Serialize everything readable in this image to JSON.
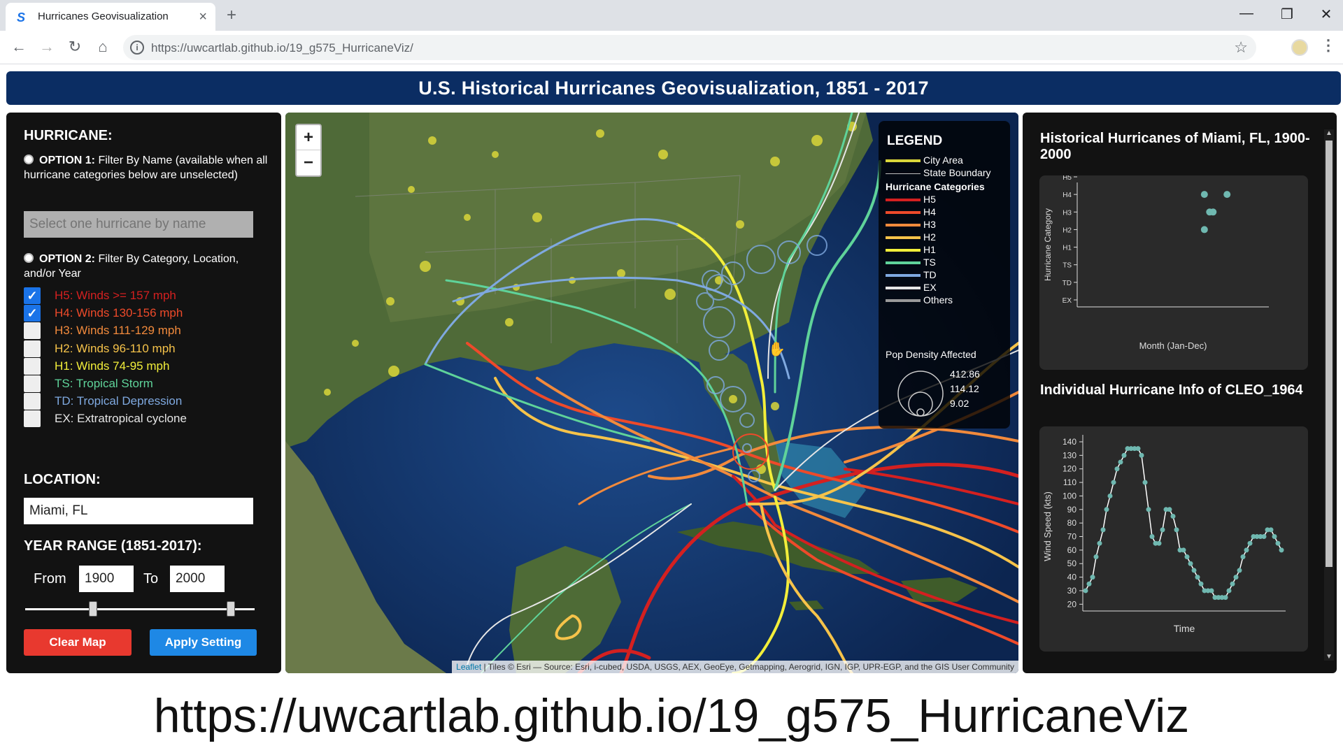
{
  "browser": {
    "tab_title": "Hurricanes Geovisualization",
    "url": "https://uwcartlab.github.io/19_g575_HurricaneViz/"
  },
  "app": {
    "title": "U.S. Historical Hurricanes Geovisualization, 1851 - 2017"
  },
  "left_panel": {
    "hurricane_heading": "HURRICANE:",
    "option1_bold": "OPTION 1:",
    "option1_text": "Filter By Name (available when all hurricane categories below are unselected)",
    "name_placeholder": "Select one hurricane by name",
    "option2_bold": "OPTION 2:",
    "option2_text": "Filter By Category, Location, and/or Year",
    "categories": [
      {
        "label": "H5: Winds >= 157 mph",
        "color": "#d42020",
        "checked": true
      },
      {
        "label": "H4: Winds 130-156 mph",
        "color": "#ee4a2a",
        "checked": true
      },
      {
        "label": "H3: Winds 111-129 mph",
        "color": "#f28a3c",
        "checked": false
      },
      {
        "label": "H2: Winds 96-110 mph",
        "color": "#f6c34a",
        "checked": false
      },
      {
        "label": "H1: Winds 74-95 mph",
        "color": "#f2ee3a",
        "checked": false
      },
      {
        "label": "TS: Tropical Storm",
        "color": "#5fd39a",
        "checked": false
      },
      {
        "label": "TD: Tropical Depression",
        "color": "#7fa9e0",
        "checked": false
      },
      {
        "label": "EX: Extratropical cyclone",
        "color": "#e6e6e6",
        "checked": false
      }
    ],
    "location_heading": "LOCATION:",
    "location_value": "Miami, FL",
    "year_heading": "YEAR RANGE (1851-2017):",
    "from_label": "From",
    "from_value": "1900",
    "to_label": "To",
    "to_value": "2000",
    "year_slider": {
      "min": 1851,
      "max": 2017,
      "from": 1900,
      "to": 2000
    },
    "clear_label": "Clear Map",
    "apply_label": "Apply Setting"
  },
  "map": {
    "zoom_in": "+",
    "zoom_out": "−",
    "legend": {
      "title": "LEGEND",
      "city_area": "City Area",
      "state_boundary": "State Boundary",
      "categories_heading": "Hurricane Categories",
      "items": [
        {
          "label": "H5",
          "color": "#d42020"
        },
        {
          "label": "H4",
          "color": "#ee4a2a"
        },
        {
          "label": "H3",
          "color": "#f28a3c"
        },
        {
          "label": "H2",
          "color": "#f6c34a"
        },
        {
          "label": "H1",
          "color": "#f2ee3a"
        },
        {
          "label": "TS",
          "color": "#5fd39a"
        },
        {
          "label": "TD",
          "color": "#7fa9e0"
        },
        {
          "label": "EX",
          "color": "#e6e6e6"
        },
        {
          "label": "Others",
          "color": "#9a9a9a"
        }
      ],
      "pop_heading": "Pop Density Affected",
      "pop_values": [
        "412.86",
        "114.12",
        "9.02"
      ]
    },
    "attribution_link": "Leaflet",
    "attribution_text": " | Tiles © Esri — Source: Esri, i-cubed, USDA, USGS, AEX, GeoEye, Getmapping, Aerogrid, IGN, IGP, UPR-EGP, and the GIS User Community"
  },
  "right_panel": {
    "chart1_title": "Historical Hurricanes of Miami, FL, 1900-2000",
    "chart2_title": "Individual Hurricane Info of CLEO_1964"
  },
  "chart_data": [
    {
      "type": "scatter",
      "title": "Historical Hurricanes of Miami, FL, 1900-2000",
      "xlabel": "Month (Jan-Dec)",
      "ylabel": "Hurricane Category",
      "categories_y": [
        "EX",
        "TD",
        "TS",
        "H1",
        "H2",
        "H3",
        "H4",
        "H5"
      ],
      "points": [
        {
          "x": 8.3,
          "y": "H4"
        },
        {
          "x": 9.6,
          "y": "H4"
        },
        {
          "x": 8.6,
          "y": "H3"
        },
        {
          "x": 8.8,
          "y": "H3"
        },
        {
          "x": 8.3,
          "y": "H2"
        }
      ],
      "xlim": [
        1,
        12
      ]
    },
    {
      "type": "line",
      "title": "Individual Hurricane Info of CLEO_1964",
      "xlabel": "Time",
      "ylabel": "Wind Speed (kts)",
      "ylim": [
        20,
        140
      ],
      "yticks": [
        20,
        30,
        40,
        50,
        60,
        70,
        80,
        90,
        100,
        110,
        120,
        130,
        140
      ],
      "values": [
        30,
        35,
        40,
        55,
        65,
        75,
        90,
        100,
        110,
        120,
        125,
        130,
        135,
        135,
        135,
        135,
        130,
        110,
        90,
        70,
        65,
        65,
        75,
        90,
        90,
        85,
        75,
        60,
        60,
        55,
        50,
        45,
        40,
        35,
        30,
        30,
        30,
        25,
        25,
        25,
        25,
        30,
        35,
        40,
        45,
        55,
        60,
        65,
        70,
        70,
        70,
        70,
        75,
        75,
        70,
        65,
        60
      ]
    }
  ],
  "caption": "https://uwcartlab.github.io/19_g575_HurricaneViz"
}
